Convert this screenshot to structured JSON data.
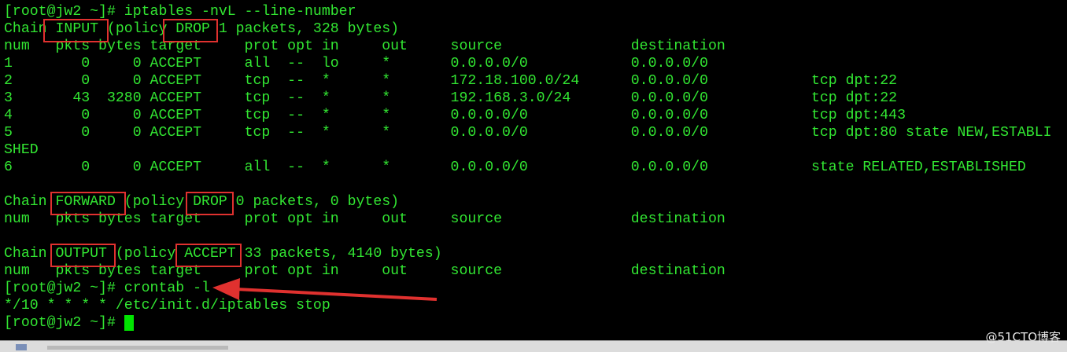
{
  "terminal": {
    "lines": [
      "[root@jw2 ~]# iptables -nvL --line-number",
      "Chain INPUT (policy DROP 1 packets, 328 bytes)",
      "num   pkts bytes target     prot opt in     out     source               destination",
      "1        0     0 ACCEPT     all  --  lo     *       0.0.0.0/0            0.0.0.0/0",
      "2        0     0 ACCEPT     tcp  --  *      *       172.18.100.0/24      0.0.0.0/0            tcp dpt:22",
      "3       43  3280 ACCEPT     tcp  --  *      *       192.168.3.0/24       0.0.0.0/0            tcp dpt:22",
      "4        0     0 ACCEPT     tcp  --  *      *       0.0.0.0/0            0.0.0.0/0            tcp dpt:443",
      "5        0     0 ACCEPT     tcp  --  *      *       0.0.0.0/0            0.0.0.0/0            tcp dpt:80 state NEW,ESTABLI",
      "SHED",
      "6        0     0 ACCEPT     all  --  *      *       0.0.0.0/0            0.0.0.0/0            state RELATED,ESTABLISHED",
      "",
      "Chain FORWARD (policy DROP 0 packets, 0 bytes)",
      "num   pkts bytes target     prot opt in     out     source               destination",
      "",
      "Chain OUTPUT (policy ACCEPT 33 packets, 4140 bytes)",
      "num   pkts bytes target     prot opt in     out     source               destination",
      "[root@jw2 ~]# crontab -l",
      "*/10 * * * * /etc/init.d/iptables stop",
      "[root@jw2 ~]# "
    ]
  },
  "annotations": {
    "boxes": [
      "INPUT",
      "DROP",
      "FORWARD",
      "DROP",
      "OUTPUT",
      "ACCEPT"
    ],
    "arrow_target": "crontab -l",
    "color": "#e0312f"
  },
  "colors": {
    "background": "#000000",
    "text": "#32e632",
    "cursor": "#00e400"
  },
  "watermark": "@51CTO博客"
}
